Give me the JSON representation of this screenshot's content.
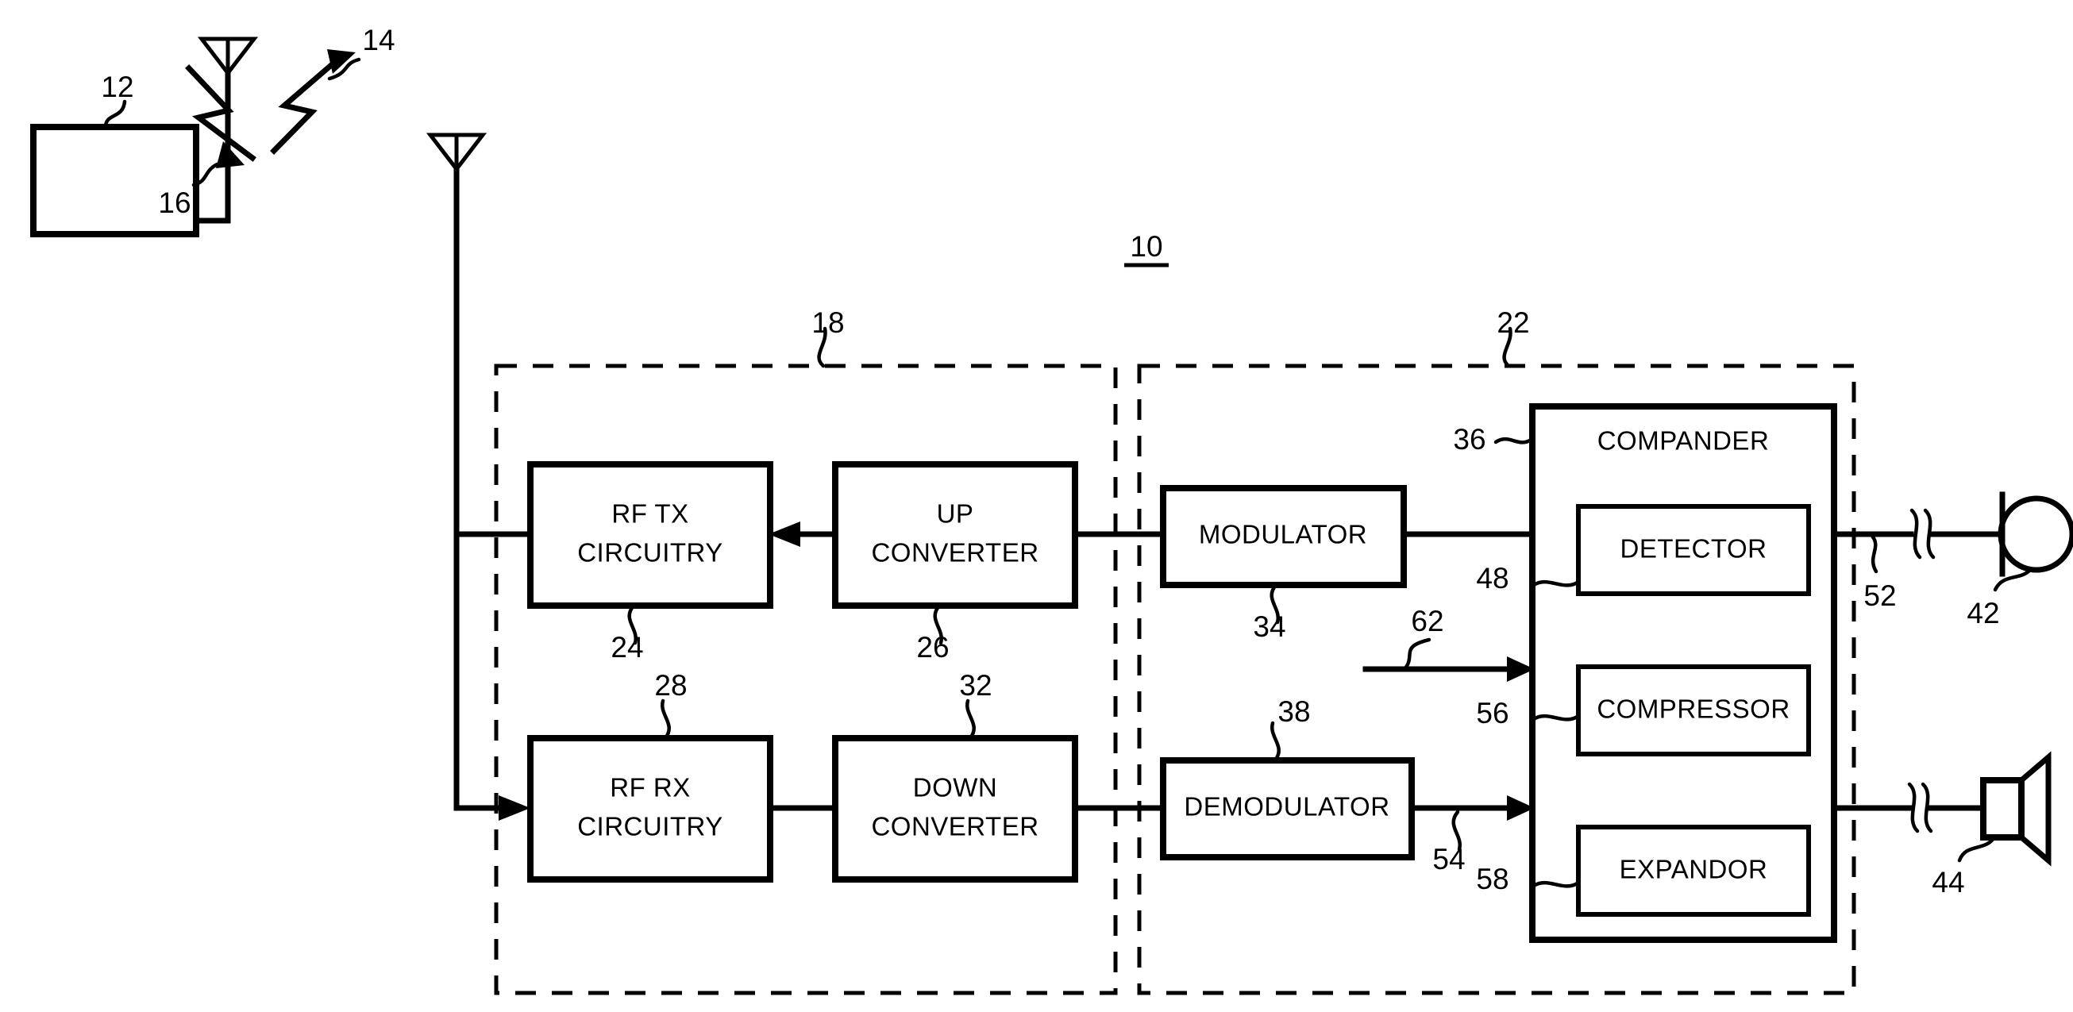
{
  "figure": {
    "label": "10",
    "label_underlined": true,
    "type": "patent-block-diagram",
    "line_color": "#000000",
    "background": "#ffffff"
  },
  "remote_unit": {
    "box_ref": "12",
    "antenna_ref": null,
    "signal_up_ref": "14",
    "signal_down_ref": "16"
  },
  "transceiver_section": {
    "ref": "18",
    "blocks": [
      {
        "ref": "24",
        "label_line1": "RF TX",
        "label_line2": "CIRCUITRY"
      },
      {
        "ref": "26",
        "label_line1": "UP",
        "label_line2": "CONVERTER"
      },
      {
        "ref": "28",
        "label_line1": "RF RX",
        "label_line2": "CIRCUITRY"
      },
      {
        "ref": "32",
        "label_line1": "DOWN",
        "label_line2": "CONVERTER"
      }
    ]
  },
  "baseband_section": {
    "ref": "22",
    "blocks": [
      {
        "ref": "34",
        "label": "MODULATOR"
      },
      {
        "ref": "38",
        "label": "DEMODULATOR"
      }
    ],
    "compander": {
      "ref": "36",
      "label": "COMPANDER",
      "sub_blocks": [
        {
          "ref": "48",
          "label": "DETECTOR"
        },
        {
          "ref": "56",
          "label": "COMPRESSOR"
        },
        {
          "ref": "58",
          "label": "EXPANDOR"
        }
      ]
    },
    "signal_refs": {
      "control_in": "62",
      "demod_out": "54",
      "mic_line": "52"
    }
  },
  "transducers": [
    {
      "ref": "42",
      "kind": "microphone-icon"
    },
    {
      "ref": "44",
      "kind": "speaker-icon"
    }
  ],
  "all_reference_numerals": [
    "10",
    "12",
    "14",
    "16",
    "18",
    "22",
    "24",
    "26",
    "28",
    "32",
    "34",
    "36",
    "38",
    "42",
    "44",
    "48",
    "52",
    "54",
    "56",
    "58",
    "62"
  ]
}
